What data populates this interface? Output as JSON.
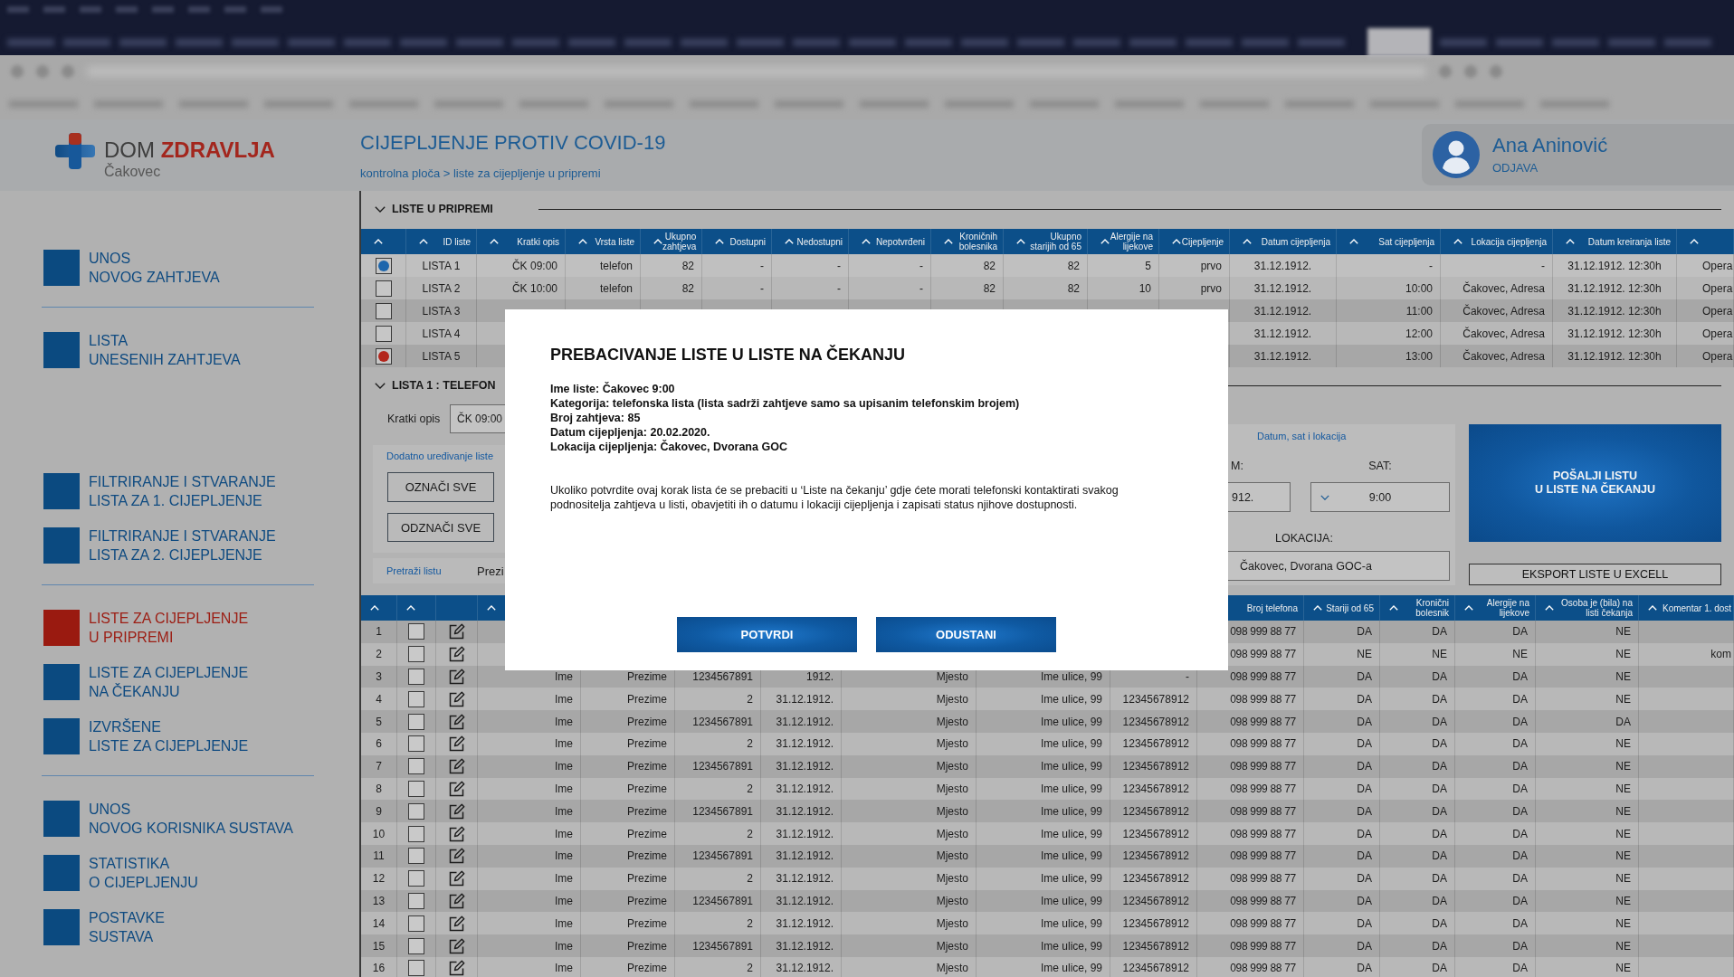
{
  "logo": {
    "name": "DOM **ZDRAVLJA**",
    "city": "Čakovec"
  },
  "header": {
    "title": "CIJEPLJENJE PROTIV COVID-19",
    "breadcrumb": "kontrolna ploča > liste za cijepljenje u pripremi"
  },
  "user": {
    "name": "Ana Aninović",
    "logout": "ODJAVA"
  },
  "sidebar": {
    "groups": [
      {
        "divider": false,
        "items": [
          {
            "label": "UNOS\nNOVOG ZAHTJEVA",
            "selected": false
          }
        ]
      },
      {
        "divider": true,
        "items": [
          {
            "label": "LISTA\nUNESENIH ZAHTJEVA",
            "selected": false
          }
        ]
      },
      {
        "divider": false,
        "items": [
          {
            "label": "FILTRIRANJE I STVARANJE\nLISTA ZA 1. CIJEPLJENJE",
            "selected": false
          },
          {
            "label": "FILTRIRANJE I STVARANJE\nLISTA ZA 2. CIJEPLJENJE",
            "selected": false
          }
        ]
      },
      {
        "divider": true,
        "items": [
          {
            "label": "LISTE ZA CIJEPLJENJE\nU PRIPREMI",
            "selected": true
          },
          {
            "label": "LISTE ZA CIJEPLJENJE\nNA ČEKANJU",
            "selected": false
          },
          {
            "label": "IZVRŠENE\nLISTE ZA CIJEPLJENJE",
            "selected": false
          }
        ]
      },
      {
        "divider": true,
        "items": [
          {
            "label": "UNOS\nNOVOG KORISNIKA SUSTAVA",
            "selected": false
          },
          {
            "label": "STATISTIKA\nO CIJEPLJENJU",
            "selected": false
          },
          {
            "label": "POSTAVKE\nSUSTAVA",
            "selected": false
          }
        ]
      }
    ]
  },
  "pending_lists": {
    "title": "LISTE U PRIPREMI",
    "expanded": true,
    "select_column": {
      "sortable": true
    },
    "columns": [
      {
        "label": "ID liste",
        "sortable": true
      },
      {
        "label": "Kratki opis",
        "sortable": true
      },
      {
        "label": "Vrsta liste",
        "sortable": true
      },
      {
        "label": "Ukupno\nzahtjeva",
        "sortable": true
      },
      {
        "label": "Dostupni",
        "sortable": true
      },
      {
        "label": "Nedostupni",
        "sortable": true
      },
      {
        "label": "Nepotvrđeni",
        "sortable": true
      },
      {
        "label": "Kroničnih\nbolesnika",
        "sortable": true
      },
      {
        "label": "Ukupno\nstarijih od 65",
        "sortable": true
      },
      {
        "label": "Alergije na\nlijekove",
        "sortable": true
      },
      {
        "label": "Cijepljenje",
        "sortable": true
      },
      {
        "label": "Datum cijepljenja",
        "sortable": true
      },
      {
        "label": "Sat cijepljenja",
        "sortable": true
      },
      {
        "label": "Lokacija cijepljenja",
        "sortable": true
      },
      {
        "label": "Datum kreiranja liste",
        "sortable": true
      },
      {
        "sortable": true
      }
    ],
    "rows": [
      {
        "selected": true,
        "color": "#1e66ac",
        "cells": [
          "LISTA 1",
          "ČK 09:00",
          "telefon",
          "82",
          "-",
          "-",
          "-",
          "82",
          "82",
          "5",
          "prvo",
          "31.12.1912.",
          "-",
          "-",
          "31.12.1912. 12:30h",
          "Opera"
        ]
      },
      {
        "selected": false,
        "cells": [
          "LISTA 2",
          "ČK 10:00",
          "telefon",
          "82",
          "-",
          "-",
          "-",
          "82",
          "82",
          "10",
          "prvo",
          "31.12.1912.",
          "10:00",
          "Čakovec, Adresa",
          "31.12.1912. 12:30h",
          "Opera"
        ]
      },
      {
        "selected": false,
        "cells": [
          "LISTA 3",
          null,
          null,
          null,
          null,
          null,
          null,
          null,
          null,
          null,
          null,
          "31.12.1912.",
          "11:00",
          "Čakovec, Adresa",
          "31.12.1912. 12:30h",
          "Opera"
        ]
      },
      {
        "selected": false,
        "cells": [
          "LISTA 4",
          null,
          null,
          null,
          null,
          null,
          null,
          null,
          null,
          null,
          null,
          "31.12.1912.",
          "12:00",
          "Čakovec, Adresa",
          "31.12.1912. 12:30h",
          "Opera"
        ]
      },
      {
        "selected": false,
        "color": "#b3261c",
        "cells": [
          "LISTA 5",
          null,
          null,
          null,
          null,
          null,
          null,
          null,
          null,
          null,
          null,
          "31.12.1912.",
          "13:00",
          "Čakovec, Adresa",
          "31.12.1912. 12:30h",
          "Opera"
        ]
      }
    ]
  },
  "list_detail": {
    "title": "LISTA 1 : TELEFON",
    "expanded": true,
    "short_description": {
      "label": "Kratki opis",
      "value": "ČK 09:00"
    },
    "edit_link": "Dodatno uređivanje liste",
    "buttons": [
      "OZNAČI SVE",
      "ODZNAČI SVE"
    ],
    "search": {
      "label": "Pretraži listu",
      "option": "Prezi"
    },
    "schedule": {
      "title": "Datum, sat i lokacija",
      "date_label": "M:",
      "date_value": "912.",
      "time_label": "SAT:",
      "time_value": "9:00",
      "location_label": "LOKACIJA:",
      "location_value": "Čakovec, Dvorana GOC-a"
    },
    "send_button": "POŠALJI LISTU\nU LISTE NA ČEKANJU",
    "export_button": "EKSPORT LISTE U EXCELL"
  },
  "requests": {
    "number_column": {
      "sortable": true
    },
    "checkbox_column": {
      "sortable": true
    },
    "columns": [
      {
        "sortable": true
      },
      null,
      null,
      null,
      null,
      null,
      null,
      {
        "label": "Broj telefona"
      },
      {
        "label": "Stariji od 65",
        "sortable": true
      },
      {
        "label": "Kronični\nbolesnik",
        "sortable": true
      },
      {
        "label": "Alergije na\nlijekove",
        "sortable": true
      },
      {
        "label": "Osoba je (bila) na\nlisti čekanja",
        "sortable": true
      },
      {
        "label": "Komentar 1. dost",
        "sortable": true
      }
    ],
    "rows": [
      {
        "number": "1",
        "checked": false,
        "cells": [
          null,
          null,
          null,
          null,
          null,
          null,
          null,
          "098 999 88 77",
          "DA",
          "DA",
          "DA",
          "NE",
          null
        ]
      },
      {
        "number": "2",
        "checked": false,
        "cells": [
          null,
          null,
          null,
          null,
          null,
          null,
          null,
          "098 999 88 77",
          "NE",
          "NE",
          "NE",
          "NE",
          "kom"
        ]
      },
      {
        "number": "3",
        "checked": false,
        "cells": [
          "Ime",
          "Prezime",
          "1234567891",
          "1912.",
          "Mjesto",
          "Ime ulice, 99",
          "-",
          "098 999 88 77",
          "DA",
          "DA",
          "DA",
          "NE",
          null
        ]
      },
      {
        "number": "4",
        "checked": false,
        "cells": [
          "Ime",
          "Prezime",
          "2",
          "31.12.1912.",
          "Mjesto",
          "Ime ulice, 99",
          "12345678912",
          "098 999 88 77",
          "DA",
          "DA",
          "DA",
          "NE",
          null
        ]
      },
      {
        "number": "5",
        "checked": false,
        "cells": [
          "Ime",
          "Prezime",
          "1234567891",
          "31.12.1912.",
          "Mjesto",
          "Ime ulice, 99",
          "12345678912",
          "098 999 88 77",
          "DA",
          "DA",
          "DA",
          "DA",
          null
        ]
      },
      {
        "number": "6",
        "checked": false,
        "cells": [
          "Ime",
          "Prezime",
          "2",
          "31.12.1912.",
          "Mjesto",
          "Ime ulice, 99",
          "12345678912",
          "098 999 88 77",
          "DA",
          "DA",
          "DA",
          "NE",
          null
        ]
      },
      {
        "number": "7",
        "checked": false,
        "cells": [
          "Ime",
          "Prezime",
          "1234567891",
          "31.12.1912.",
          "Mjesto",
          "Ime ulice, 99",
          "12345678912",
          "098 999 88 77",
          "DA",
          "DA",
          "DA",
          "NE",
          null
        ]
      },
      {
        "number": "8",
        "checked": false,
        "cells": [
          "Ime",
          "Prezime",
          "2",
          "31.12.1912.",
          "Mjesto",
          "Ime ulice, 99",
          "12345678912",
          "098 999 88 77",
          "DA",
          "DA",
          "DA",
          "NE",
          null
        ]
      },
      {
        "number": "9",
        "checked": false,
        "cells": [
          "Ime",
          "Prezime",
          "1234567891",
          "31.12.1912.",
          "Mjesto",
          "Ime ulice, 99",
          "12345678912",
          "098 999 88 77",
          "DA",
          "DA",
          "DA",
          "NE",
          null
        ]
      },
      {
        "number": "10",
        "checked": false,
        "cells": [
          "Ime",
          "Prezime",
          "2",
          "31.12.1912.",
          "Mjesto",
          "Ime ulice, 99",
          "12345678912",
          "098 999 88 77",
          "DA",
          "DA",
          "DA",
          "NE",
          null
        ]
      },
      {
        "number": "11",
        "checked": false,
        "cells": [
          "Ime",
          "Prezime",
          "1234567891",
          "31.12.1912.",
          "Mjesto",
          "Ime ulice, 99",
          "12345678912",
          "098 999 88 77",
          "DA",
          "DA",
          "DA",
          "NE",
          null
        ]
      },
      {
        "number": "12",
        "checked": false,
        "cells": [
          "Ime",
          "Prezime",
          "2",
          "31.12.1912.",
          "Mjesto",
          "Ime ulice, 99",
          "12345678912",
          "098 999 88 77",
          "DA",
          "DA",
          "DA",
          "NE",
          null
        ]
      },
      {
        "number": "13",
        "checked": false,
        "cells": [
          "Ime",
          "Prezime",
          "1234567891",
          "31.12.1912.",
          "Mjesto",
          "Ime ulice, 99",
          "12345678912",
          "098 999 88 77",
          "DA",
          "DA",
          "DA",
          "NE",
          null
        ]
      },
      {
        "number": "14",
        "checked": false,
        "cells": [
          "Ime",
          "Prezime",
          "2",
          "31.12.1912.",
          "Mjesto",
          "Ime ulice, 99",
          "12345678912",
          "098 999 88 77",
          "DA",
          "DA",
          "DA",
          "NE",
          null
        ]
      },
      {
        "number": "15",
        "checked": false,
        "cells": [
          "Ime",
          "Prezime",
          "1234567891",
          "31.12.1912.",
          "Mjesto",
          "Ime ulice, 99",
          "12345678912",
          "098 999 88 77",
          "DA",
          "DA",
          "DA",
          "NE",
          null
        ]
      },
      {
        "number": "16",
        "checked": false,
        "cells": [
          "Ime",
          "Prezime",
          "2",
          "31.12.1912.",
          "Mjesto",
          "Ime ulice, 99",
          "12345678912",
          "098 999 88 77",
          "DA",
          "DA",
          "DA",
          "NE",
          null
        ]
      }
    ]
  },
  "dialog": {
    "title": "PREBACIVANJE LISTE U LISTE NA ČEKANJU",
    "details": [
      "Ime liste: Čakovec 9:00",
      "Kategorija: telefonska lista (lista sadrži zahtjeve samo sa upisanim telefonskim brojem)",
      "Broj zahtjeva: 85",
      "Datum cijepljenja: 20.02.2020.",
      "Lokacija cijepljenja: Čakovec, Dvorana GOC"
    ],
    "message": "Ukoliko potvrdite ovaj korak lista će se prebaciti u ‘Liste na čekanju’ gdje ćete morati telefonski kontaktirati svakog podnositelja zahtjeva u listi, obavjetiti ih o datumu i lokaciji cijepljenja i zapisati status njihove dostupnosti.",
    "buttons": [
      "POTVRDI",
      "ODUSTANI"
    ]
  }
}
